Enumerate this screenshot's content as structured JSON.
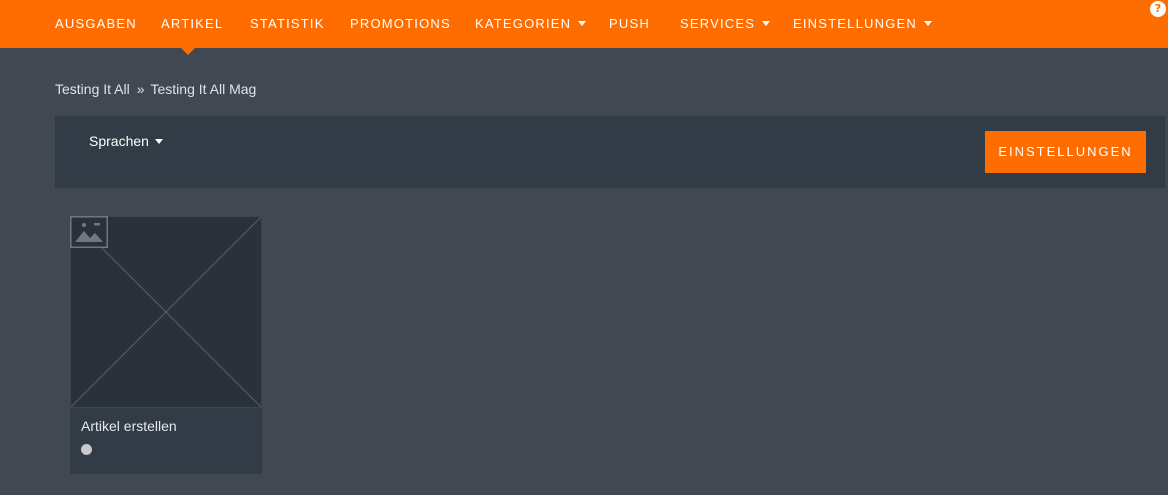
{
  "nav": {
    "items": [
      {
        "label": "AUSGABEN",
        "dropdown": false
      },
      {
        "label": "ARTIKEL",
        "dropdown": false,
        "active": true
      },
      {
        "label": "STATISTIK",
        "dropdown": false
      },
      {
        "label": "PROMOTIONS",
        "dropdown": false
      },
      {
        "label": "KATEGORIEN",
        "dropdown": true
      },
      {
        "label": "PUSH",
        "dropdown": false
      },
      {
        "label": "SERVICES",
        "dropdown": true
      },
      {
        "label": "EINSTELLUNGEN",
        "dropdown": true
      }
    ],
    "help_icon": "?"
  },
  "breadcrumb": {
    "items": [
      "Testing It All",
      "Testing It All Mag"
    ],
    "separator": "»"
  },
  "toolbar": {
    "language_label": "Sprachen",
    "settings_label": "EINSTELLUNGEN"
  },
  "articles": [
    {
      "title": "Artikel erstellen",
      "icon": "image-placeholder-icon"
    }
  ],
  "colors": {
    "accent": "#ff6d00",
    "background": "#414852",
    "panel": "#323c47",
    "thumbnail": "#2a3138"
  }
}
